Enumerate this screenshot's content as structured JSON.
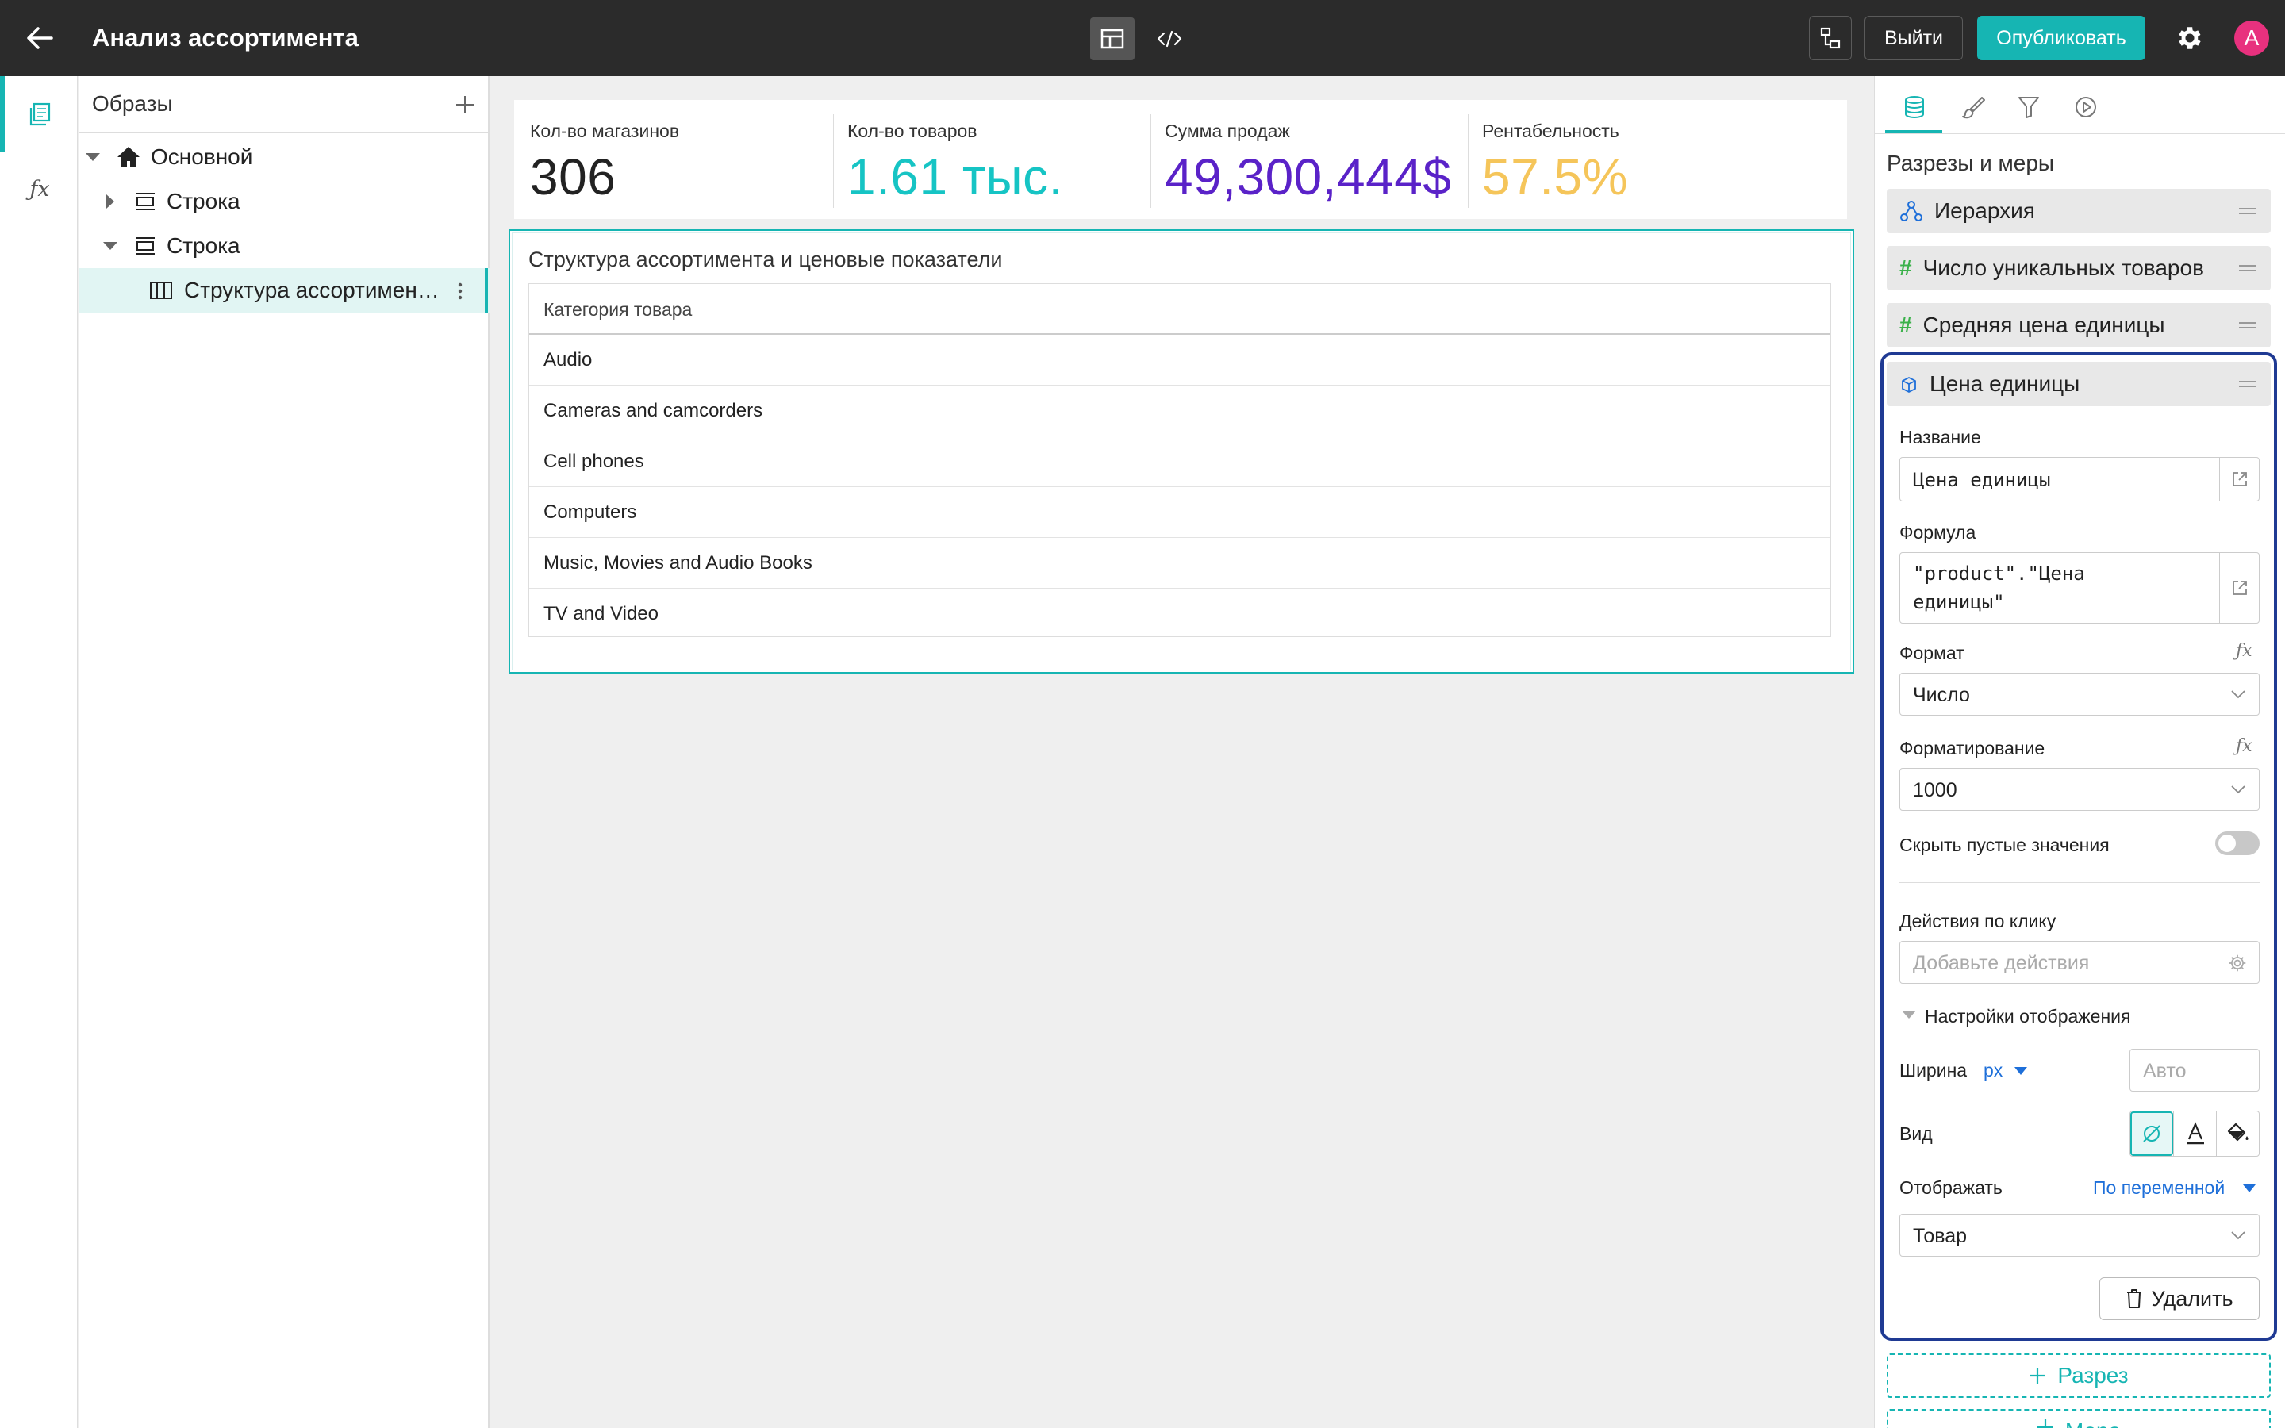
{
  "header": {
    "title": "Анализ ассортимента",
    "exit_label": "Выйти",
    "publish_label": "Опубликовать",
    "avatar_letter": "A"
  },
  "tree": {
    "title": "Образы",
    "items": [
      {
        "label": "Основной"
      },
      {
        "label": "Строка"
      },
      {
        "label": "Строка"
      },
      {
        "label": "Структура ассортимен…"
      }
    ]
  },
  "kpis": [
    {
      "label": "Кол-во магазинов",
      "value": "306",
      "color": "#222222"
    },
    {
      "label": "Кол-во товаров",
      "value": "1.61 тыс.",
      "color": "#16c4c4"
    },
    {
      "label": "Сумма продаж",
      "value": "49,300,444$",
      "color": "#5a22c8"
    },
    {
      "label": "Рентабельность",
      "value": "57.5%",
      "color": "#f5c55a"
    }
  ],
  "table": {
    "title": "Структура ассортимента и ценовые показатели",
    "column": "Категория товара",
    "rows": [
      "Audio",
      "Cameras and camcorders",
      "Cell phones",
      "Computers",
      "Music, Movies and Audio Books",
      "TV and Video"
    ]
  },
  "panel": {
    "heading": "Разрезы и меры",
    "fields": [
      {
        "label": "Иерархия"
      },
      {
        "label": "Число уникальных товаров"
      },
      {
        "label": "Средняя цена единицы"
      }
    ],
    "editor": {
      "field_label": "Цена единицы",
      "name_label": "Название",
      "name_value": "Цена единицы",
      "formula_label": "Формула",
      "formula_line1": "\"product\".\"Цена",
      "formula_line2": "единицы\"",
      "format_label": "Формат",
      "format_value": "Число",
      "formatting_label": "Форматирование",
      "formatting_value": "1000",
      "hide_empty_label": "Скрыть пустые значения",
      "hide_empty_on": false,
      "actions_label": "Действия по клику",
      "actions_placeholder": "Добавьте действия",
      "display_settings_label": "Настройки отображения",
      "width_label": "Ширина",
      "width_unit": "px",
      "width_placeholder": "Авто",
      "view_label": "Вид",
      "show_label": "Отображать",
      "show_mode": "По переменной",
      "show_value": "Товар",
      "delete_label": "Удалить"
    },
    "add_slice_label": "Разрез",
    "add_measure_label": "Мера"
  },
  "colors": {
    "accent": "#16b5b3",
    "topbar": "#2b2b2b",
    "editor_border": "#1f3a93",
    "avatar": "#e8317e",
    "link": "#1e6fd9"
  }
}
